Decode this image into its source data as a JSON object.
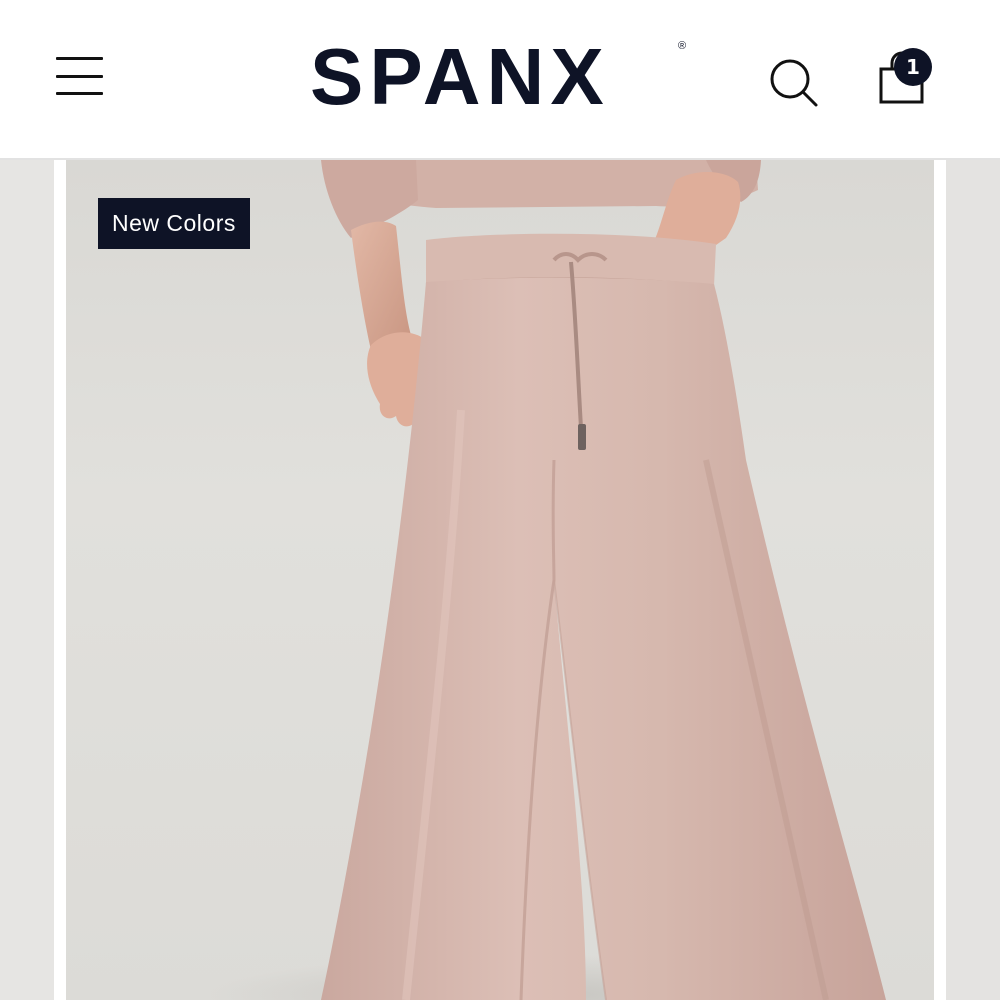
{
  "header": {
    "logo_text": "SPANX",
    "logo_registered": "®",
    "cart_count": "1"
  },
  "icons": {
    "menu": "hamburger-menu-icon",
    "search": "search-icon",
    "cart": "shopping-bag-icon"
  },
  "product_image": {
    "badge": "New Colors",
    "product_color": "#d9bcb3",
    "background_color": "#dcdbd7"
  },
  "colors": {
    "brand_navy": "#0e1326",
    "header_background": "#ffffff"
  }
}
